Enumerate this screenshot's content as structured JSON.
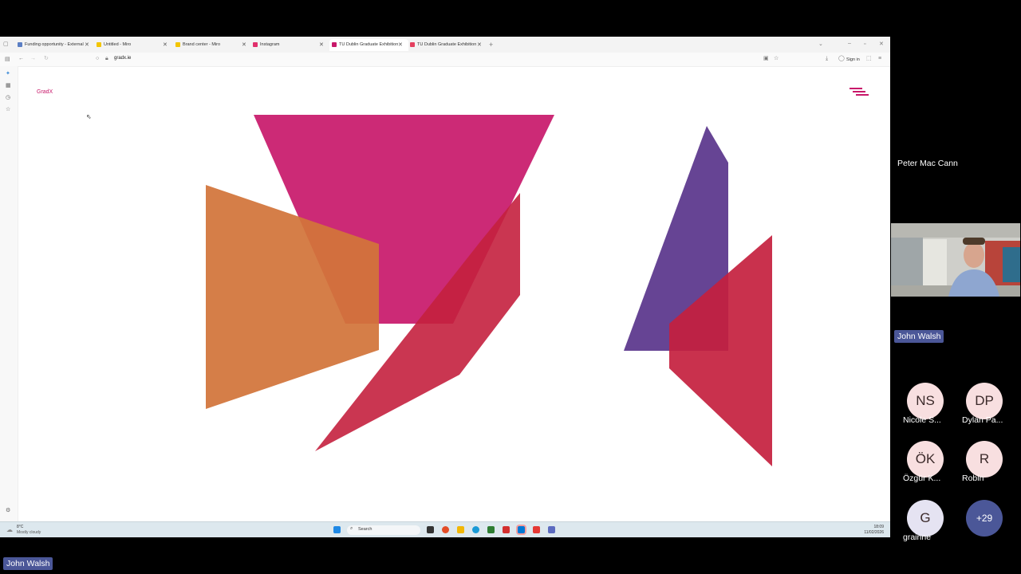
{
  "browser": {
    "tabs": [
      {
        "label": "Funding opportunity - External",
        "color": "#5b7fc4"
      },
      {
        "label": "Untitled - Miro",
        "color": "#f3c500"
      },
      {
        "label": "Brand center - Miro",
        "color": "#f3c500"
      },
      {
        "label": "Instagram",
        "color": "#e1306c"
      },
      {
        "label": "TU Dublin Graduate Exhibition",
        "color": "#c8186a"
      },
      {
        "label": "TU Dublin Graduate Exhibition",
        "color": "#e4405f"
      }
    ],
    "active_tab": 4,
    "url": "gradx.ie",
    "sign_in": "Sign in"
  },
  "page": {
    "logo": "GradX",
    "colors": {
      "magenta": "#c8186a",
      "orange": "#d2743a",
      "crimson": "#c4203e",
      "purple": "#5e3a8e"
    }
  },
  "taskbar": {
    "weather_temp": "8°C",
    "weather_desc": "Mostly cloudy",
    "search_placeholder": "Search",
    "time": "18:09",
    "date": "11/02/2026"
  },
  "meeting": {
    "active_speaker": "Peter Mac Cann",
    "video_label": "John Walsh",
    "participants": [
      {
        "initials": "NS",
        "name": "Nicole S..."
      },
      {
        "initials": "DP",
        "name": "Dylan Pa..."
      },
      {
        "initials": "ÖK",
        "name": "Özgür K..."
      },
      {
        "initials": "R",
        "name": "Robin"
      },
      {
        "initials": "G",
        "name": "grainne"
      }
    ],
    "more_count": "+29",
    "presenter_label": "John Walsh"
  }
}
